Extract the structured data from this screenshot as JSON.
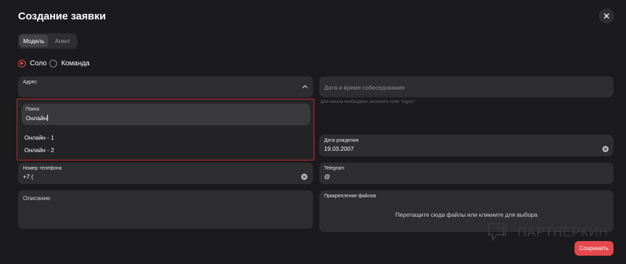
{
  "modal": {
    "title": "Создание заявки"
  },
  "tabs": [
    {
      "label": "Модель",
      "active": true
    },
    {
      "label": "Агент",
      "active": false
    }
  ],
  "mode": {
    "options": [
      {
        "label": "Соло",
        "selected": true
      },
      {
        "label": "Команда",
        "selected": false
      }
    ]
  },
  "address": {
    "label": "Адрес",
    "search": {
      "label": "Поиск",
      "value": "Онлайн"
    },
    "options": [
      "Онлайн - 1",
      "Онлайн - 2"
    ]
  },
  "interview": {
    "placeholder": "Дата и время собеседования",
    "hint": "Для начала необходимо заполнить поле \"Адрес\""
  },
  "birthdate": {
    "label": "Дата рождения",
    "value": "19.03.2007"
  },
  "phone": {
    "label": "Номер телефона",
    "value": "+7 ("
  },
  "telegram": {
    "label": "Telegram",
    "value": "@"
  },
  "description": {
    "label": "Описание"
  },
  "attachments": {
    "label": "Прикрепление файлов",
    "dropzone_text": "Перетащите сюда файлы или кликните для выбора"
  },
  "actions": {
    "save_label": "Сохранить"
  },
  "watermark": {
    "text": "ПАРТНЕРКИН"
  },
  "colors": {
    "accent": "#e5484d",
    "background": "#1b1b1d",
    "field": "#2e2e31",
    "dropdown_border": "#c8282c"
  }
}
